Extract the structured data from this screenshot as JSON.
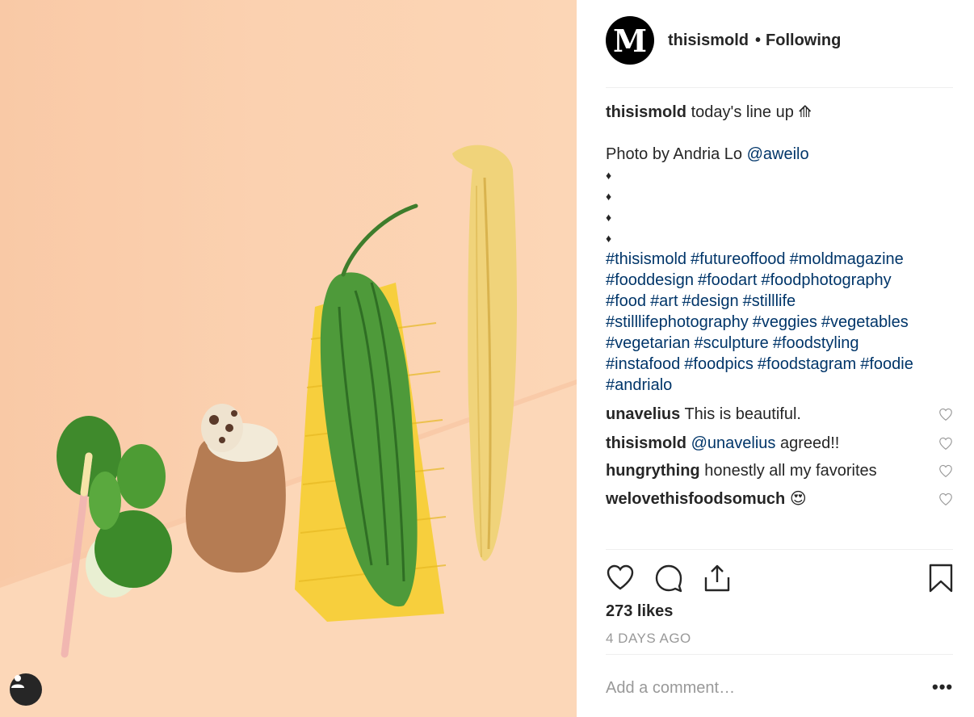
{
  "post": {
    "username": "thisismold",
    "follow_status": "Following",
    "avatar_letter": "M",
    "likes": "273 likes",
    "time_ago": "4 DAYS AGO",
    "add_comment_placeholder": "Add a comment…",
    "more_label": "•••",
    "header_separator": "•"
  },
  "caption": {
    "username": "thisismold",
    "text": "today's line up ⟰",
    "credit_text": "Photo by Andria Lo",
    "credit_mention": "@aweilo",
    "diamonds": [
      "♦",
      "♦",
      "♦",
      "♦"
    ],
    "hashtags": [
      "#thisismold",
      "#futureoffood",
      "#moldmagazine",
      "#fooddesign",
      "#foodart",
      "#foodphotography",
      "#food",
      "#art",
      "#design",
      "#stilllife",
      "#stilllifephotography",
      "#veggies",
      "#vegetables",
      "#vegetarian",
      "#sculpture",
      "#foodstyling",
      "#instafood",
      "#foodpics",
      "#foodstagram",
      "#foodie",
      "#andrialo"
    ]
  },
  "comments": [
    {
      "username": "unavelius",
      "mention": "",
      "text": "This is beautiful."
    },
    {
      "username": "thisismold",
      "mention": "@unavelius",
      "text": "agreed!!"
    },
    {
      "username": "hungrything",
      "mention": "",
      "text": "honestly all my favorites"
    },
    {
      "username": "welovethisfoodsomuch",
      "mention": "",
      "text": "😍"
    }
  ],
  "icons": {
    "like": "heart-icon",
    "comment": "comment-bubble-icon",
    "share": "share-icon",
    "save": "bookmark-icon",
    "user_tag": "user-tag-icon"
  },
  "colors": {
    "text": "#262626",
    "link": "#003569",
    "muted": "#999999",
    "divider": "#efefef"
  }
}
